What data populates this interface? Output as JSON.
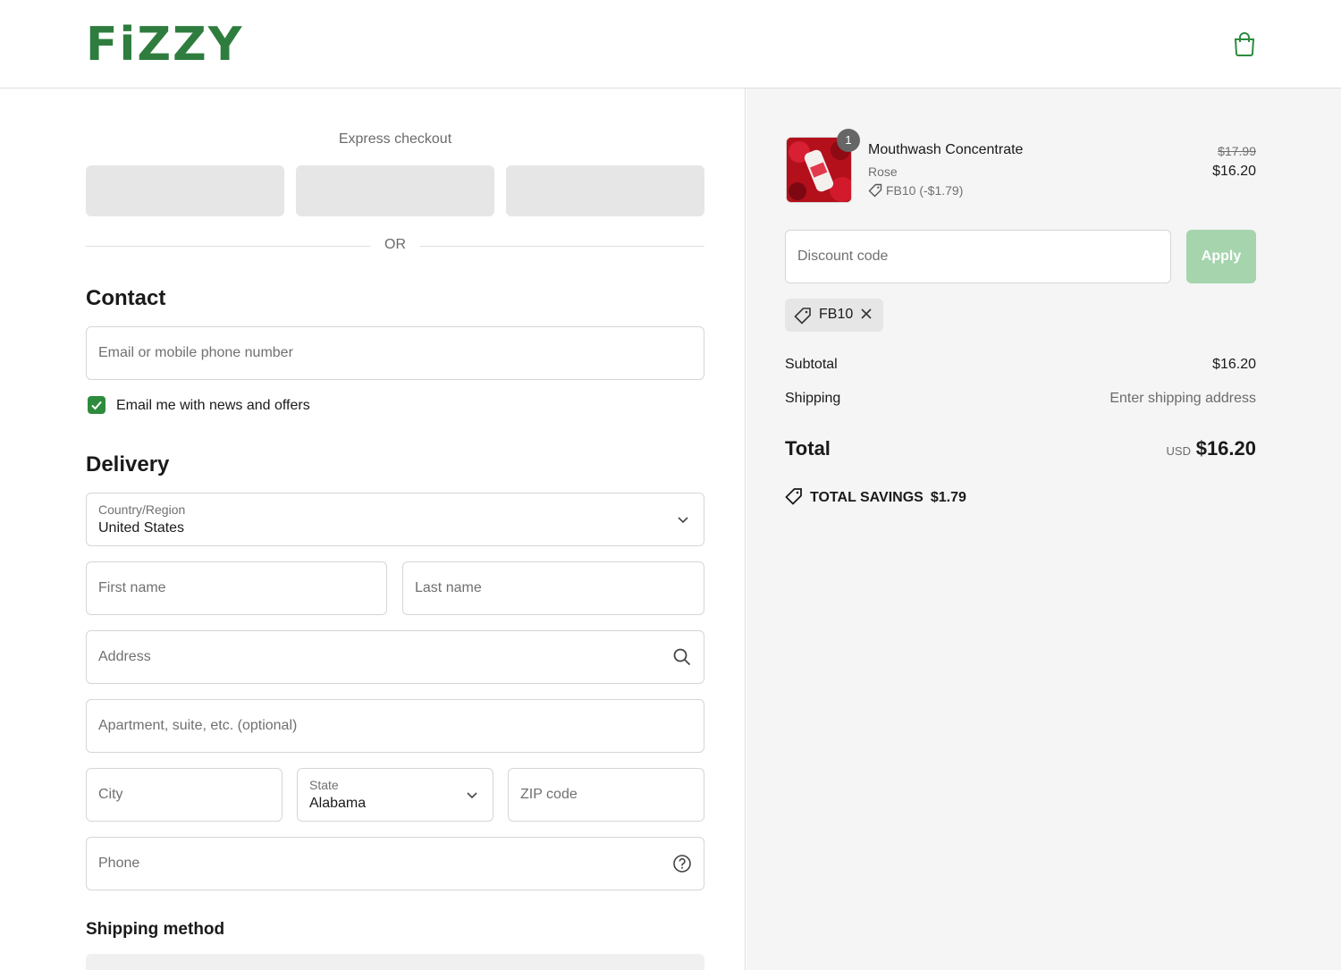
{
  "brand": {
    "logo_text": "FiZZY",
    "accent": "#2e7d3e"
  },
  "header": {
    "cart_icon": "shopping-bag-icon"
  },
  "express": {
    "title": "Express checkout",
    "buttons": [
      "",
      "",
      ""
    ]
  },
  "divider": {
    "or": "OR"
  },
  "contact": {
    "title": "Contact",
    "email_placeholder": "Email or mobile phone number",
    "newsletter_label": "Email me with news and offers",
    "newsletter_checked": true
  },
  "delivery": {
    "title": "Delivery",
    "country_label": "Country/Region",
    "country_value": "United States",
    "first_name_placeholder": "First name",
    "last_name_placeholder": "Last name",
    "address_placeholder": "Address",
    "apartment_placeholder": "Apartment, suite, etc. (optional)",
    "city_placeholder": "City",
    "state_label": "State",
    "state_value": "Alabama",
    "zip_placeholder": "ZIP code",
    "phone_placeholder": "Phone"
  },
  "shipping_method": {
    "title": "Shipping method"
  },
  "summary": {
    "product": {
      "quantity": "1",
      "name": "Mouthwash Concentrate",
      "variant": "Rose",
      "discount": "FB10 (-$1.79)",
      "price_original": "$17.99",
      "price_final": "$16.20"
    },
    "discount_placeholder": "Discount code",
    "apply_label": "Apply",
    "applied_code": "FB10",
    "subtotal_label": "Subtotal",
    "subtotal_value": "$16.20",
    "shipping_label": "Shipping",
    "shipping_value": "Enter shipping address",
    "total_label": "Total",
    "currency": "USD",
    "total_value": "$16.20",
    "savings_label": "TOTAL SAVINGS",
    "savings_value": "$1.79"
  }
}
